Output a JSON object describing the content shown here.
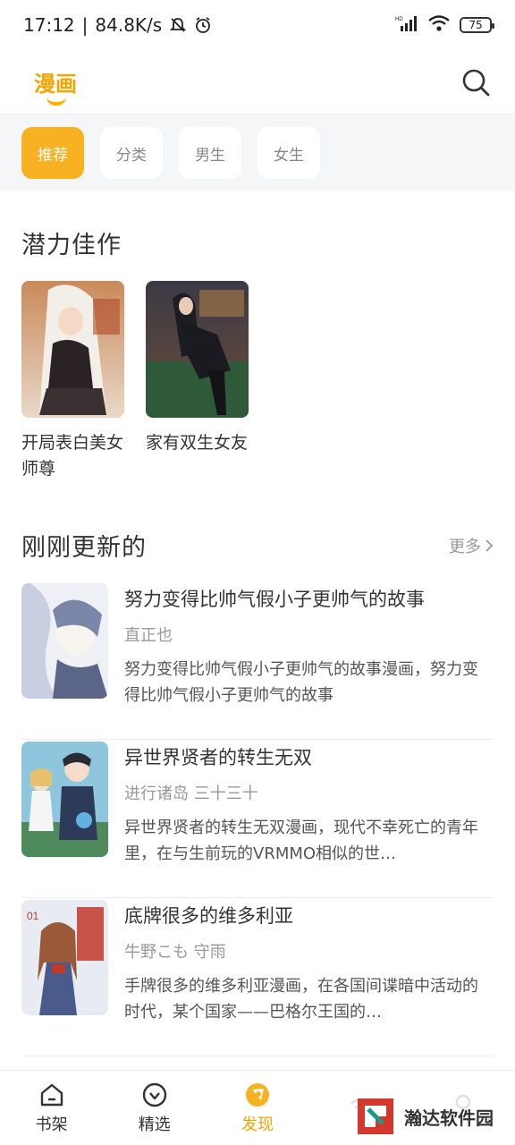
{
  "status_bar": {
    "time": "17:12",
    "net_speed": "84.8K/s",
    "battery": "75"
  },
  "header": {
    "title": "漫画",
    "search_icon": "search-icon"
  },
  "tabs": [
    {
      "label": "推荐",
      "active": true
    },
    {
      "label": "分类",
      "active": false
    },
    {
      "label": "男生",
      "active": false
    },
    {
      "label": "女生",
      "active": false
    }
  ],
  "potential": {
    "title": "潜力佳作",
    "items": [
      {
        "name": "开局表白美女师尊"
      },
      {
        "name": "家有双生女友"
      }
    ]
  },
  "updated": {
    "title": "刚刚更新的",
    "more": "更多",
    "items": [
      {
        "title": "努力变得比帅气假小子更帅气的故事",
        "author": "直正也",
        "desc": "努力变得比帅气假小子更帅气的故事漫画，努力变得比帅气假小子更帅气的故事"
      },
      {
        "title": "异世界贤者的转生无双",
        "author": "进行诸岛 三十三十",
        "desc": "异世界贤者的转生无双漫画，现代不幸死亡的青年里，在与生前玩的VRMMO相似的世…"
      },
      {
        "title": "底牌很多的维多利亚",
        "author": "牛野こも 守雨",
        "desc": "手牌很多的维多利亚漫画，在各国间谍暗中活动的时代，某个国家——巴格尔王国的…"
      }
    ]
  },
  "bottom_nav": [
    {
      "label": "书架",
      "icon": "home-icon",
      "active": false
    },
    {
      "label": "精选",
      "icon": "heart-circle-icon",
      "active": false
    },
    {
      "label": "发现",
      "icon": "discover-icon",
      "active": true
    },
    {
      "label": "",
      "icon": "signal-icon",
      "active": false
    },
    {
      "label": "",
      "icon": "profile-icon",
      "active": false
    }
  ],
  "watermark": {
    "text": "瀚达软件园"
  },
  "colors": {
    "accent": "#f7b121",
    "accent_text": "#f5a500"
  }
}
